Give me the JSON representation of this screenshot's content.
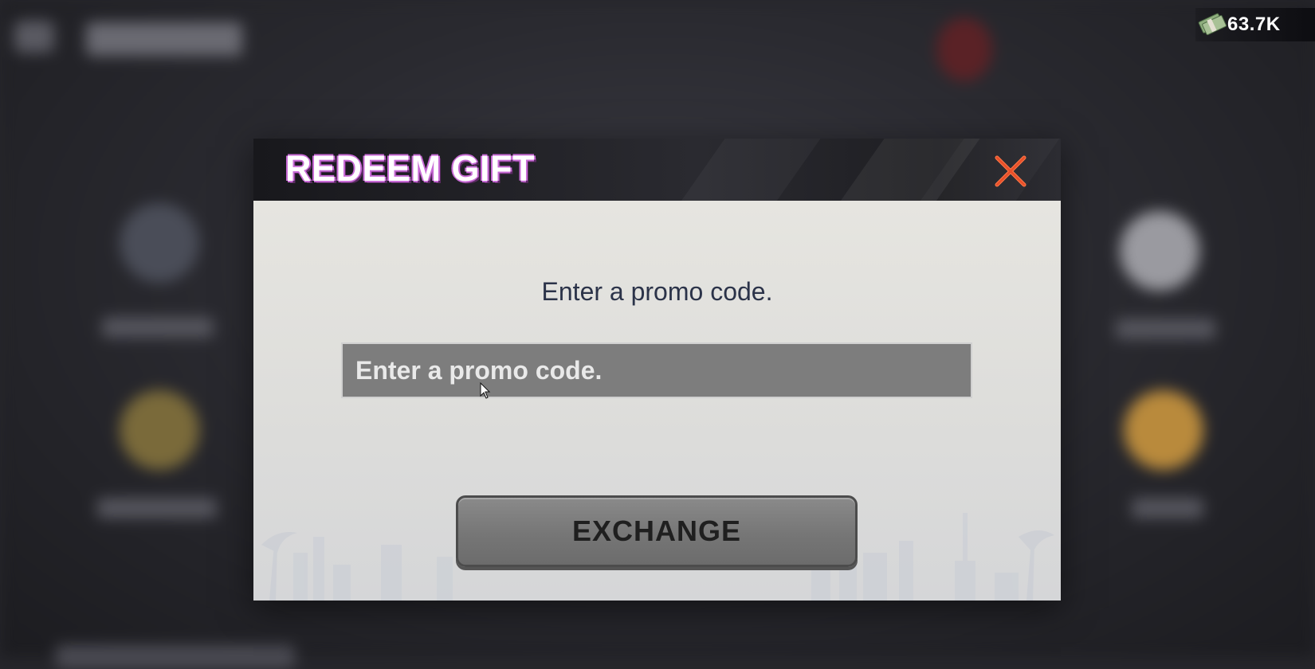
{
  "currency": {
    "amount": "63.7K",
    "icon": "cash-icon"
  },
  "dialog": {
    "title": "REDEEM GIFT",
    "close_icon": "close-icon",
    "prompt": "Enter a promo code.",
    "input": {
      "placeholder": "Enter a promo code.",
      "value": ""
    },
    "exchange_label": "EXCHANGE"
  },
  "colors": {
    "title_outline": "#c86bd6",
    "close_x": "#e8502a",
    "input_bg": "#7d7d7d",
    "button_bg": "#777777",
    "prompt_text": "#2b3349"
  }
}
